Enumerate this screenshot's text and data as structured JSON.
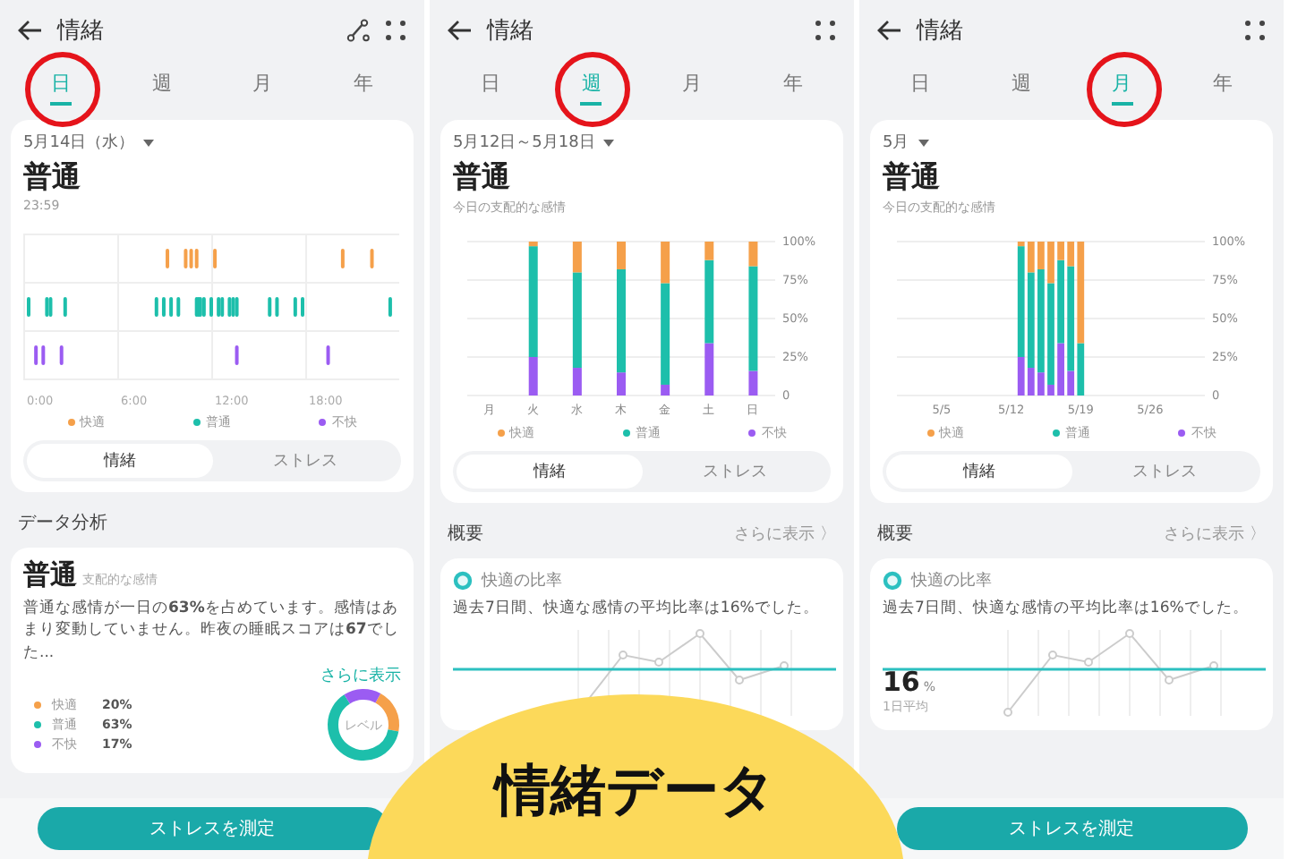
{
  "screens": [
    {
      "header": {
        "title": "情緒",
        "actions": [
          {
            "kind": "route"
          },
          {
            "kind": "grid"
          }
        ]
      },
      "tabs": [
        {
          "label": "日",
          "selected": true,
          "circled": true
        },
        {
          "label": "週",
          "selected": false,
          "circled": false
        },
        {
          "label": "月",
          "selected": false,
          "circled": false
        },
        {
          "label": "年",
          "selected": false,
          "circled": false
        }
      ],
      "period": "5月14日（水）",
      "mood": "普通",
      "caption": "23:59",
      "timeline": {
        "xticks": [
          "0:00",
          "6:00",
          "12:00",
          "18:00"
        ]
      },
      "legend": [
        {
          "label": "快適",
          "color": "#f5a04a"
        },
        {
          "label": "普通",
          "color": "#1dbfab"
        },
        {
          "label": "不快",
          "color": "#9b5cf2"
        }
      ],
      "toggle": [
        {
          "label": "情緒",
          "selected": true
        },
        {
          "label": "ストレス",
          "selected": false
        }
      ],
      "section": {
        "title": "データ分析"
      },
      "analysis": {
        "mood": "普通",
        "note": "支配的な感情",
        "text": "普通な感情が一日の**63%**を占めています。感情はあまり変動していません。昨夜の睡眠スコアは**67**でした...",
        "more": "さらに表示",
        "breakdown": [
          {
            "label": "快適",
            "value": "20%",
            "color": "#f5a04a"
          },
          {
            "label": "普通",
            "value": "63%",
            "color": "#1dbfab"
          },
          {
            "label": "不快",
            "value": "17%",
            "color": "#9b5cf2"
          }
        ],
        "donut": {
          "label": "レベル"
        }
      },
      "footer_button": "ストレスを測定"
    },
    {
      "header": {
        "title": "情緒",
        "actions": [
          {
            "kind": "grid"
          }
        ]
      },
      "tabs": [
        {
          "label": "日",
          "selected": false,
          "circled": false
        },
        {
          "label": "週",
          "selected": true,
          "circled": true
        },
        {
          "label": "月",
          "selected": false,
          "circled": false
        },
        {
          "label": "年",
          "selected": false,
          "circled": false
        }
      ],
      "period": "5月12日～5月18日",
      "mood": "普通",
      "caption": "今日の支配的な感情",
      "chart_data": {
        "type": "bar",
        "stacked": true,
        "grid": true,
        "categories": [
          "月",
          "火",
          "水",
          "木",
          "金",
          "土",
          "日"
        ],
        "ylim": [
          0,
          100
        ],
        "yticks": [
          0,
          {
            "value": 25,
            "label": "25%"
          },
          {
            "value": 50,
            "label": "50%"
          },
          {
            "value": 75,
            "label": "75%"
          },
          {
            "value": 100,
            "label": "100%"
          }
        ],
        "series": [
          {
            "name": "不快",
            "color": "#9b5cf2",
            "values": [
              null,
              25,
              18,
              15,
              7,
              34,
              16
            ]
          },
          {
            "name": "普通",
            "color": "#1dbfab",
            "values": [
              null,
              72,
              62,
              67,
              66,
              54,
              68
            ]
          },
          {
            "name": "快適",
            "color": "#f5a04a",
            "values": [
              null,
              3,
              20,
              18,
              27,
              12,
              16
            ]
          }
        ]
      },
      "toggle": [
        {
          "label": "情緒",
          "selected": true
        },
        {
          "label": "ストレス",
          "selected": false
        }
      ],
      "section": {
        "title": "概要",
        "more": "さらに表示 〉"
      },
      "ratio": {
        "title": "快適の比率",
        "text": "過去7日間、快適な感情の平均比率は16%でした。"
      }
    },
    {
      "header": {
        "title": "情緒",
        "actions": [
          {
            "kind": "grid"
          }
        ]
      },
      "tabs": [
        {
          "label": "日",
          "selected": false,
          "circled": false
        },
        {
          "label": "週",
          "selected": false,
          "circled": false
        },
        {
          "label": "月",
          "selected": true,
          "circled": true
        },
        {
          "label": "年",
          "selected": false,
          "circled": false
        }
      ],
      "period": "5月",
      "mood": "普通",
      "caption": "今日の支配的な感情",
      "chart_data": {
        "type": "bar",
        "stacked": true,
        "grid": true,
        "categories": [
          null,
          null,
          null,
          null,
          "5/5",
          null,
          null,
          null,
          null,
          null,
          null,
          "5/12",
          null,
          null,
          null,
          null,
          null,
          null,
          "5/19",
          null,
          null,
          null,
          null,
          null,
          null,
          "5/26",
          null,
          null,
          null,
          null,
          null
        ],
        "ylim": [
          0,
          100
        ],
        "yticks": [
          0,
          {
            "value": 25,
            "label": "25%"
          },
          {
            "value": 50,
            "label": "50%"
          },
          {
            "value": 75,
            "label": "75%"
          },
          {
            "value": 100,
            "label": "100%"
          }
        ],
        "series": [
          {
            "name": "不快",
            "color": "#9b5cf2",
            "values": [
              null,
              null,
              null,
              null,
              null,
              null,
              null,
              null,
              null,
              null,
              null,
              null,
              25,
              18,
              15,
              7,
              34,
              16,
              0,
              null,
              null,
              null,
              null,
              null,
              null,
              null,
              null,
              null,
              null,
              null,
              null
            ]
          },
          {
            "name": "普通",
            "color": "#1dbfab",
            "values": [
              null,
              null,
              null,
              null,
              null,
              null,
              null,
              null,
              null,
              null,
              null,
              null,
              72,
              62,
              67,
              66,
              54,
              68,
              34,
              null,
              null,
              null,
              null,
              null,
              null,
              null,
              null,
              null,
              null,
              null,
              null
            ]
          },
          {
            "name": "快適",
            "color": "#f5a04a",
            "values": [
              null,
              null,
              null,
              null,
              null,
              null,
              null,
              null,
              null,
              null,
              null,
              null,
              3,
              20,
              18,
              27,
              12,
              16,
              66,
              null,
              null,
              null,
              null,
              null,
              null,
              null,
              null,
              null,
              null,
              null,
              null
            ]
          }
        ]
      },
      "toggle": [
        {
          "label": "情緒",
          "selected": true
        },
        {
          "label": "ストレス",
          "selected": false
        }
      ],
      "section": {
        "title": "概要",
        "more": "さらに表示 〉"
      },
      "ratio": {
        "title": "快適の比率",
        "text": "過去7日間、快適な感情の平均比率は16%でした。",
        "value": "16",
        "unit": "%",
        "value_note": "1日平均"
      },
      "footer_button": "ストレスを測定"
    }
  ],
  "overlay": {
    "title": "情緒データ"
  }
}
